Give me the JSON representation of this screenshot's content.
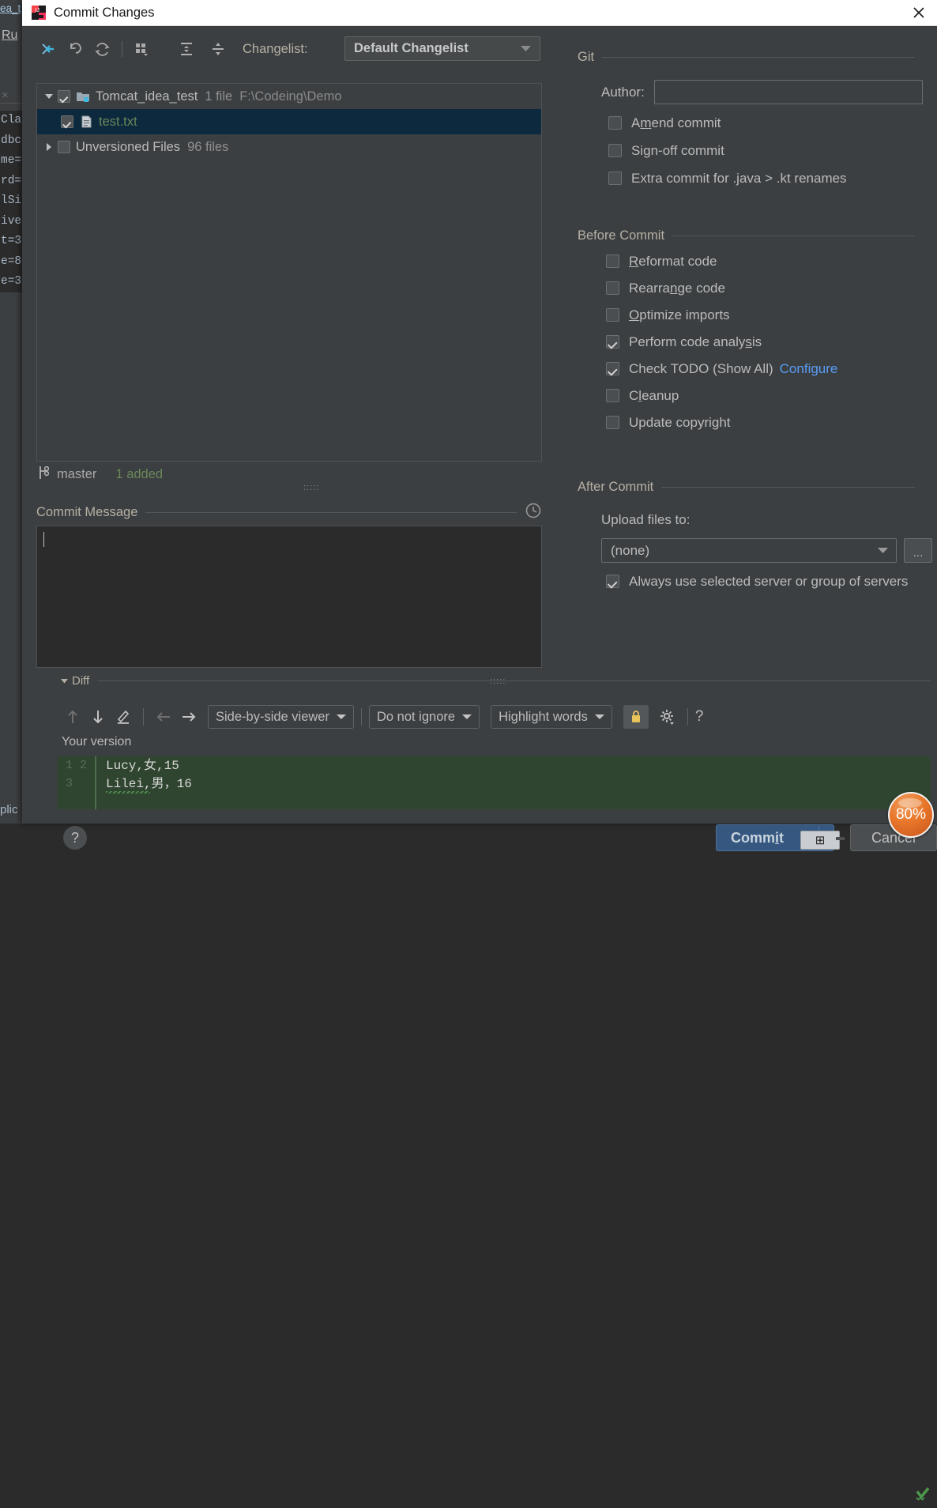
{
  "background_window": {
    "tab_fragment": "ea_t",
    "run_label": "Ru",
    "close_glyph": "×",
    "editor_fragments": [
      "Cla",
      "dbc",
      "me=",
      "rd=",
      "lSi",
      "ive",
      "t=3",
      "e=8",
      "e=3"
    ],
    "bottom_fragment": "plic",
    "right_fragment": ")"
  },
  "dialog": {
    "title": "Commit Changes",
    "logo_name": "intellij-idea-logo",
    "close_label": "×"
  },
  "changelist": {
    "toolbar": [
      {
        "name": "move-to-another-changelist-icon",
        "tooltip": "Move to Another Changelist"
      },
      {
        "name": "rollback-icon",
        "tooltip": "Rollback"
      },
      {
        "name": "refresh-icon",
        "tooltip": "Refresh"
      },
      {
        "name": "group-by-icon",
        "tooltip": "Group By"
      },
      {
        "name": "expand-all-icon",
        "tooltip": "Expand All"
      },
      {
        "name": "collapse-all-icon",
        "tooltip": "Collapse All"
      }
    ],
    "label": "Changelist:",
    "selected": "Default Changelist",
    "options": [
      "Default Changelist"
    ],
    "tree": [
      {
        "expanded": true,
        "checked": true,
        "icon": "changelist-folder-icon",
        "label": "Tomcat_idea_test",
        "count": "1 file",
        "path": "F:\\Codeing\\Demo",
        "selected": false,
        "children": [
          {
            "checked": true,
            "icon": "text-file-icon",
            "label": "test.txt",
            "selected": true
          }
        ]
      },
      {
        "expanded": false,
        "checked": false,
        "label": "Unversioned Files",
        "count": "96 files",
        "selected": false
      }
    ],
    "branch_icon": "git-branch-icon",
    "branch": "master",
    "added_status": "1 added"
  },
  "commit_message": {
    "label": "Commit Message",
    "history_icon": "clock-icon",
    "value": "",
    "placeholder": ""
  },
  "git_section": {
    "title": "Git",
    "author_label": "Author:",
    "author_value": "",
    "author_placeholder": "",
    "checkboxes": [
      {
        "label": "Amend commit",
        "mnemonic": "m",
        "checked": false
      },
      {
        "label": "Sign-off commit",
        "mnemonic": "g",
        "checked": false
      },
      {
        "label": "Extra commit for .java > .kt renames",
        "mnemonic": "",
        "checked": false
      }
    ]
  },
  "before_commit": {
    "title": "Before Commit",
    "checkboxes": [
      {
        "label": "Reformat code",
        "mnemonic": "R",
        "checked": false
      },
      {
        "label": "Rearrange code",
        "mnemonic": "n",
        "checked": false
      },
      {
        "label": "Optimize imports",
        "mnemonic": "O",
        "checked": false
      },
      {
        "label": "Perform code analysis",
        "mnemonic": "s",
        "checked": true
      },
      {
        "label": "Check TODO (Show All)",
        "mnemonic": "",
        "checked": true,
        "link": "Configure"
      },
      {
        "label": "Cleanup",
        "mnemonic": "l",
        "checked": false
      },
      {
        "label": "Update copyright",
        "mnemonic": "",
        "checked": false
      }
    ]
  },
  "after_commit": {
    "title": "After Commit",
    "upload_label": "Upload files to:",
    "upload_selected": "(none)",
    "upload_options": [
      "(none)"
    ],
    "ellipsis_label": "...",
    "always_use_label": "Always use selected server or group of servers",
    "always_use_checked": true
  },
  "diff": {
    "title": "Diff",
    "expanded": true,
    "toolbar": [
      {
        "name": "previous-difference-icon",
        "label": "↑",
        "enabled": false
      },
      {
        "name": "next-difference-icon",
        "label": "↓",
        "enabled": true
      },
      {
        "name": "edit-source-icon",
        "label": "✎",
        "enabled": true
      },
      {
        "name": "apply-left-icon",
        "label": "←",
        "enabled": false
      },
      {
        "name": "apply-right-icon",
        "label": "→",
        "enabled": true
      }
    ],
    "viewer_mode": "Side-by-side viewer",
    "viewer_options": [
      "Side-by-side viewer"
    ],
    "whitespace_mode": "Do not ignore",
    "whitespace_options": [
      "Do not ignore"
    ],
    "highlight_mode": "Highlight words",
    "highlight_options": [
      "Highlight words"
    ],
    "lock_icon": "lock-icon",
    "settings_icon": "gear-icon",
    "help_icon": "?",
    "pane_title": "Your version",
    "line_numbers": [
      "1",
      "2",
      "3"
    ],
    "lines": [
      "Lucy,女,15",
      "Lilei,男，16",
      ""
    ],
    "gutter_marker": "code-analysis-ok-icon"
  },
  "footer": {
    "help_label": "?",
    "commit_label": "Commit",
    "commit_mnemonic": "i",
    "commit_split_icon": "chevron-down-icon",
    "cancel_label": "Cancel"
  },
  "overlays": {
    "ime_glyph": "⊞",
    "zoom_badge": "80%"
  },
  "colors": {
    "dialog_bg": "#3c3f41",
    "editor_bg": "#2b2b2b",
    "accent_blue": "#365880",
    "link_blue": "#589df6",
    "added_green": "#6a8759",
    "diff_added_bg": "#2f452f",
    "selection_bg": "#0d293e",
    "badge_orange": "#e8762a",
    "title_bg": "#ffffff"
  }
}
